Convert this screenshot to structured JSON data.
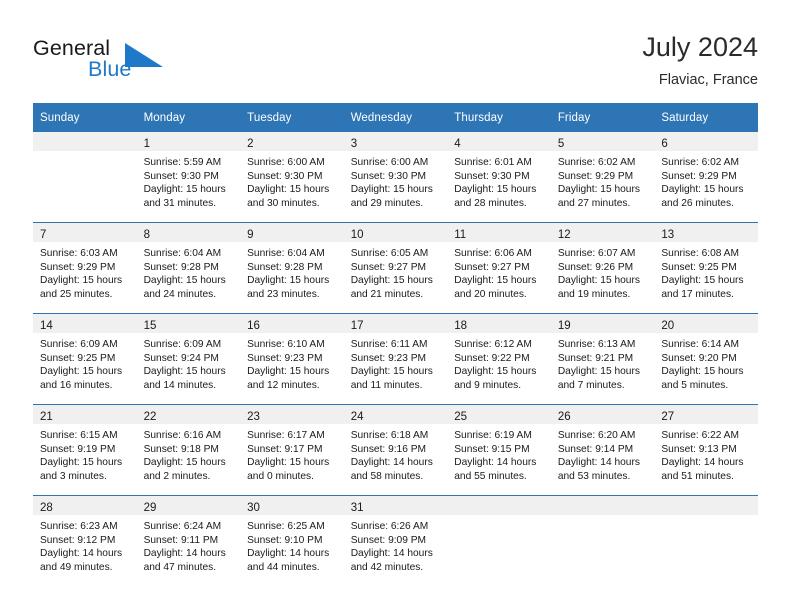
{
  "brand": {
    "name_part1": "General",
    "name_part2": "Blue",
    "triangle_color": "#1e7ac8",
    "accent_color": "#2E75B6"
  },
  "header": {
    "title": "July 2024",
    "subtitle": "Flaviac, France"
  },
  "calendar": {
    "weekday_headers": [
      "Sunday",
      "Monday",
      "Tuesday",
      "Wednesday",
      "Thursday",
      "Friday",
      "Saturday"
    ],
    "weeks": [
      [
        {
          "day": "",
          "lines": []
        },
        {
          "day": "1",
          "lines": [
            "Sunrise: 5:59 AM",
            "Sunset: 9:30 PM",
            "Daylight: 15 hours",
            "and 31 minutes."
          ]
        },
        {
          "day": "2",
          "lines": [
            "Sunrise: 6:00 AM",
            "Sunset: 9:30 PM",
            "Daylight: 15 hours",
            "and 30 minutes."
          ]
        },
        {
          "day": "3",
          "lines": [
            "Sunrise: 6:00 AM",
            "Sunset: 9:30 PM",
            "Daylight: 15 hours",
            "and 29 minutes."
          ]
        },
        {
          "day": "4",
          "lines": [
            "Sunrise: 6:01 AM",
            "Sunset: 9:30 PM",
            "Daylight: 15 hours",
            "and 28 minutes."
          ]
        },
        {
          "day": "5",
          "lines": [
            "Sunrise: 6:02 AM",
            "Sunset: 9:29 PM",
            "Daylight: 15 hours",
            "and 27 minutes."
          ]
        },
        {
          "day": "6",
          "lines": [
            "Sunrise: 6:02 AM",
            "Sunset: 9:29 PM",
            "Daylight: 15 hours",
            "and 26 minutes."
          ]
        }
      ],
      [
        {
          "day": "7",
          "lines": [
            "Sunrise: 6:03 AM",
            "Sunset: 9:29 PM",
            "Daylight: 15 hours",
            "and 25 minutes."
          ]
        },
        {
          "day": "8",
          "lines": [
            "Sunrise: 6:04 AM",
            "Sunset: 9:28 PM",
            "Daylight: 15 hours",
            "and 24 minutes."
          ]
        },
        {
          "day": "9",
          "lines": [
            "Sunrise: 6:04 AM",
            "Sunset: 9:28 PM",
            "Daylight: 15 hours",
            "and 23 minutes."
          ]
        },
        {
          "day": "10",
          "lines": [
            "Sunrise: 6:05 AM",
            "Sunset: 9:27 PM",
            "Daylight: 15 hours",
            "and 21 minutes."
          ]
        },
        {
          "day": "11",
          "lines": [
            "Sunrise: 6:06 AM",
            "Sunset: 9:27 PM",
            "Daylight: 15 hours",
            "and 20 minutes."
          ]
        },
        {
          "day": "12",
          "lines": [
            "Sunrise: 6:07 AM",
            "Sunset: 9:26 PM",
            "Daylight: 15 hours",
            "and 19 minutes."
          ]
        },
        {
          "day": "13",
          "lines": [
            "Sunrise: 6:08 AM",
            "Sunset: 9:25 PM",
            "Daylight: 15 hours",
            "and 17 minutes."
          ]
        }
      ],
      [
        {
          "day": "14",
          "lines": [
            "Sunrise: 6:09 AM",
            "Sunset: 9:25 PM",
            "Daylight: 15 hours",
            "and 16 minutes."
          ]
        },
        {
          "day": "15",
          "lines": [
            "Sunrise: 6:09 AM",
            "Sunset: 9:24 PM",
            "Daylight: 15 hours",
            "and 14 minutes."
          ]
        },
        {
          "day": "16",
          "lines": [
            "Sunrise: 6:10 AM",
            "Sunset: 9:23 PM",
            "Daylight: 15 hours",
            "and 12 minutes."
          ]
        },
        {
          "day": "17",
          "lines": [
            "Sunrise: 6:11 AM",
            "Sunset: 9:23 PM",
            "Daylight: 15 hours",
            "and 11 minutes."
          ]
        },
        {
          "day": "18",
          "lines": [
            "Sunrise: 6:12 AM",
            "Sunset: 9:22 PM",
            "Daylight: 15 hours",
            "and 9 minutes."
          ]
        },
        {
          "day": "19",
          "lines": [
            "Sunrise: 6:13 AM",
            "Sunset: 9:21 PM",
            "Daylight: 15 hours",
            "and 7 minutes."
          ]
        },
        {
          "day": "20",
          "lines": [
            "Sunrise: 6:14 AM",
            "Sunset: 9:20 PM",
            "Daylight: 15 hours",
            "and 5 minutes."
          ]
        }
      ],
      [
        {
          "day": "21",
          "lines": [
            "Sunrise: 6:15 AM",
            "Sunset: 9:19 PM",
            "Daylight: 15 hours",
            "and 3 minutes."
          ]
        },
        {
          "day": "22",
          "lines": [
            "Sunrise: 6:16 AM",
            "Sunset: 9:18 PM",
            "Daylight: 15 hours",
            "and 2 minutes."
          ]
        },
        {
          "day": "23",
          "lines": [
            "Sunrise: 6:17 AM",
            "Sunset: 9:17 PM",
            "Daylight: 15 hours",
            "and 0 minutes."
          ]
        },
        {
          "day": "24",
          "lines": [
            "Sunrise: 6:18 AM",
            "Sunset: 9:16 PM",
            "Daylight: 14 hours",
            "and 58 minutes."
          ]
        },
        {
          "day": "25",
          "lines": [
            "Sunrise: 6:19 AM",
            "Sunset: 9:15 PM",
            "Daylight: 14 hours",
            "and 55 minutes."
          ]
        },
        {
          "day": "26",
          "lines": [
            "Sunrise: 6:20 AM",
            "Sunset: 9:14 PM",
            "Daylight: 14 hours",
            "and 53 minutes."
          ]
        },
        {
          "day": "27",
          "lines": [
            "Sunrise: 6:22 AM",
            "Sunset: 9:13 PM",
            "Daylight: 14 hours",
            "and 51 minutes."
          ]
        }
      ],
      [
        {
          "day": "28",
          "lines": [
            "Sunrise: 6:23 AM",
            "Sunset: 9:12 PM",
            "Daylight: 14 hours",
            "and 49 minutes."
          ]
        },
        {
          "day": "29",
          "lines": [
            "Sunrise: 6:24 AM",
            "Sunset: 9:11 PM",
            "Daylight: 14 hours",
            "and 47 minutes."
          ]
        },
        {
          "day": "30",
          "lines": [
            "Sunrise: 6:25 AM",
            "Sunset: 9:10 PM",
            "Daylight: 14 hours",
            "and 44 minutes."
          ]
        },
        {
          "day": "31",
          "lines": [
            "Sunrise: 6:26 AM",
            "Sunset: 9:09 PM",
            "Daylight: 14 hours",
            "and 42 minutes."
          ]
        },
        {
          "day": "",
          "lines": []
        },
        {
          "day": "",
          "lines": []
        },
        {
          "day": "",
          "lines": []
        }
      ]
    ]
  }
}
